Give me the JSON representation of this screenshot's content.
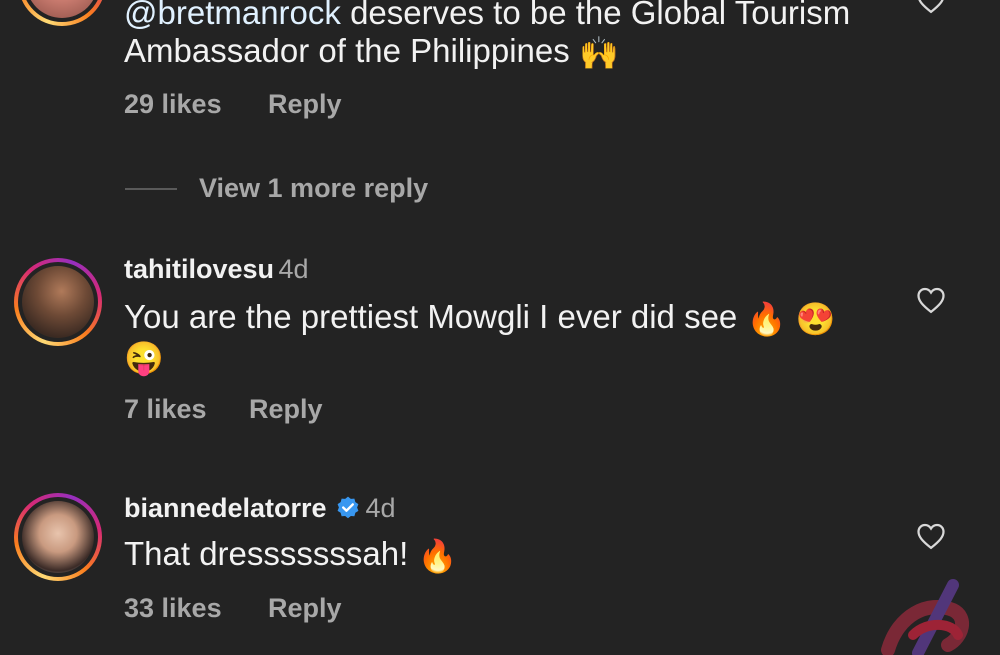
{
  "comments": [
    {
      "mention": "@bretmanrock",
      "text_line1": " deserves to be the Global Tourism",
      "text_line2": "Ambassador of the Philippines",
      "emoji": "🙌",
      "likes": "29 likes",
      "reply": "Reply",
      "view_more": "View 1 more reply"
    },
    {
      "username": "tahitilovesu",
      "time": "4d",
      "text_line1": "You are the prettiest Mowgli I ever did see",
      "emoji_line1": [
        "🔥",
        "😍"
      ],
      "emoji_line2": "😜",
      "likes": "7 likes",
      "reply": "Reply"
    },
    {
      "username": "biannedelatorre",
      "verified": true,
      "time": "4d",
      "text_line1": "That dresssssssah!",
      "emoji": "🔥",
      "likes": "33 likes",
      "reply": "Reply"
    }
  ],
  "icons": {
    "like": "heart-outline-icon",
    "verified": "verified-badge-icon",
    "watermark": "watermark-logo"
  },
  "colors": {
    "background": "#232323",
    "text": "#f2f2f2",
    "muted": "#a8a8a8",
    "verified": "#3897f0"
  }
}
